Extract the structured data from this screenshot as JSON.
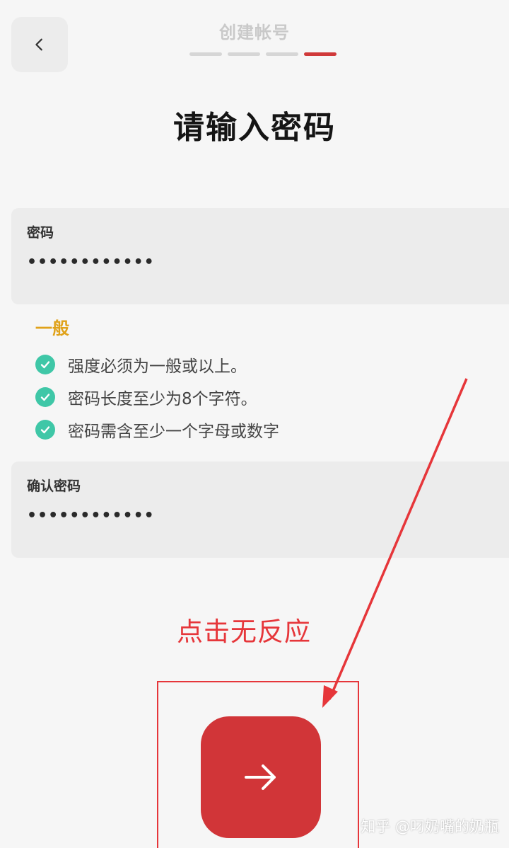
{
  "header": {
    "title": "创建帐号",
    "steps_total": 4,
    "current_step": 4
  },
  "page_title": "请输入密码",
  "password_field": {
    "label": "密码",
    "value": "••••••••••••"
  },
  "strength": {
    "label": "一般",
    "color": "#e0a21a"
  },
  "rules": [
    {
      "text": "强度必须为一般或以上。"
    },
    {
      "text": "密码长度至少为8个字符。"
    },
    {
      "text": "密码需含至少一个字母或数字"
    }
  ],
  "confirm_field": {
    "label": "确认密码",
    "value": "••••••••••••"
  },
  "annotation": {
    "text": "点击无反应",
    "color": "#e6363a"
  },
  "next_button": {
    "icon": "arrow-right-icon",
    "color": "#d13538"
  },
  "watermark": "知乎 @叼奶嘴的奶瓶"
}
